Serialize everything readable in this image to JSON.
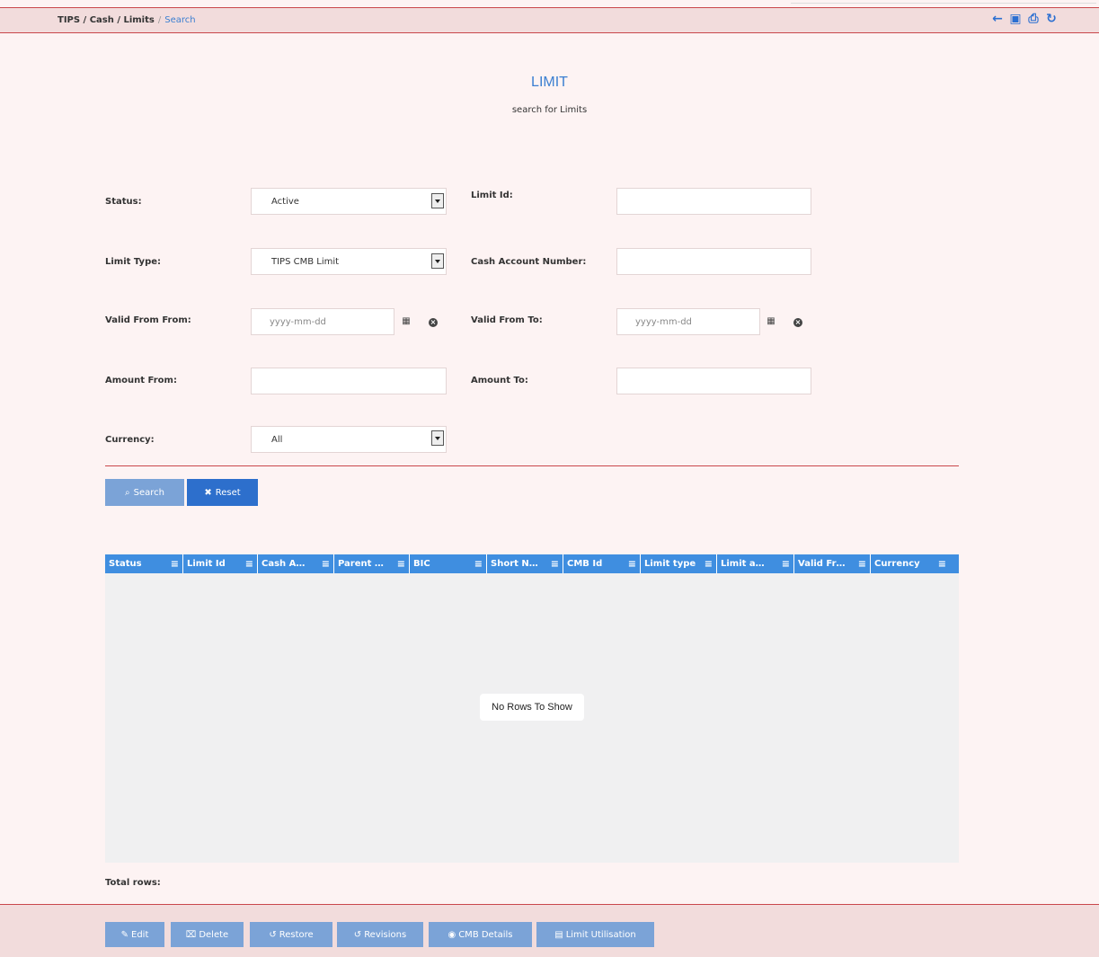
{
  "breadcrumb": {
    "part1": "TIPS / Cash / Limits",
    "sep": "/",
    "current": "Search"
  },
  "header_icons": [
    "back-icon",
    "save-icon",
    "print-icon",
    "refresh-icon"
  ],
  "page": {
    "title": "LIMIT",
    "subtitle": "search for Limits"
  },
  "form": {
    "status_label": "Status:",
    "status_value": "Active",
    "limit_id_label": "Limit Id:",
    "limit_id_value": "",
    "limit_type_label": "Limit Type:",
    "limit_type_value": "TIPS CMB Limit",
    "cash_account_label": "Cash Account Number:",
    "cash_account_value": "",
    "valid_from_from_label": "Valid From From:",
    "valid_from_from_placeholder": "yyyy-mm-dd",
    "valid_from_to_label": "Valid From To:",
    "valid_from_to_placeholder": "yyyy-mm-dd",
    "amount_from_label": "Amount From:",
    "amount_from_value": "",
    "amount_to_label": "Amount To:",
    "amount_to_value": "",
    "currency_label": "Currency:",
    "currency_value": "All"
  },
  "actions": {
    "search": "Search",
    "reset": "Reset"
  },
  "grid": {
    "columns": [
      "Status",
      "Limit Id",
      "Cash A…",
      "Parent …",
      "BIC",
      "Short N…",
      "CMB Id",
      "Limit type",
      "Limit a…",
      "Valid Fr…",
      "Currency"
    ],
    "empty_message": "No Rows To Show"
  },
  "total_rows_label": "Total rows:",
  "footer_buttons": [
    "Edit",
    "Delete",
    "Restore",
    "Revisions",
    "CMB Details",
    "Limit Utilisation"
  ],
  "colors": {
    "accent": "#3f8ee0",
    "header_bg": "#f2dcdc",
    "divider": "#c9474b",
    "button_light": "#7ba3d7",
    "button_dark": "#2d6fcc"
  }
}
